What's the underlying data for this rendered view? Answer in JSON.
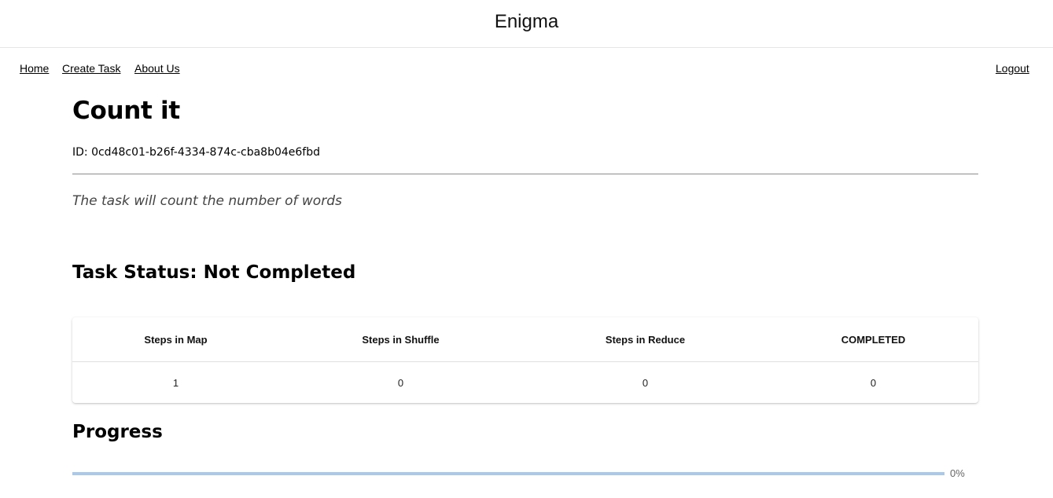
{
  "header": {
    "title": "Enigma"
  },
  "nav": {
    "home": "Home",
    "create_task": "Create Task",
    "about_us": "About Us",
    "logout": "Logout"
  },
  "task": {
    "title": "Count it",
    "id_text": "ID: 0cd48c01-b26f-4334-874c-cba8b04e6fbd",
    "description": "The task will count the number of words",
    "status_heading": "Task Status: Not Completed"
  },
  "status_table": {
    "headers": [
      "Steps in Map",
      "Steps in Shuffle",
      "Steps in Reduce",
      "COMPLETED"
    ],
    "values": [
      "1",
      "0",
      "0",
      "0"
    ]
  },
  "progress": {
    "heading": "Progress",
    "percent": 0,
    "label": "0%",
    "track_color": "#a9c8ea",
    "fill_color": "#1976d2"
  }
}
